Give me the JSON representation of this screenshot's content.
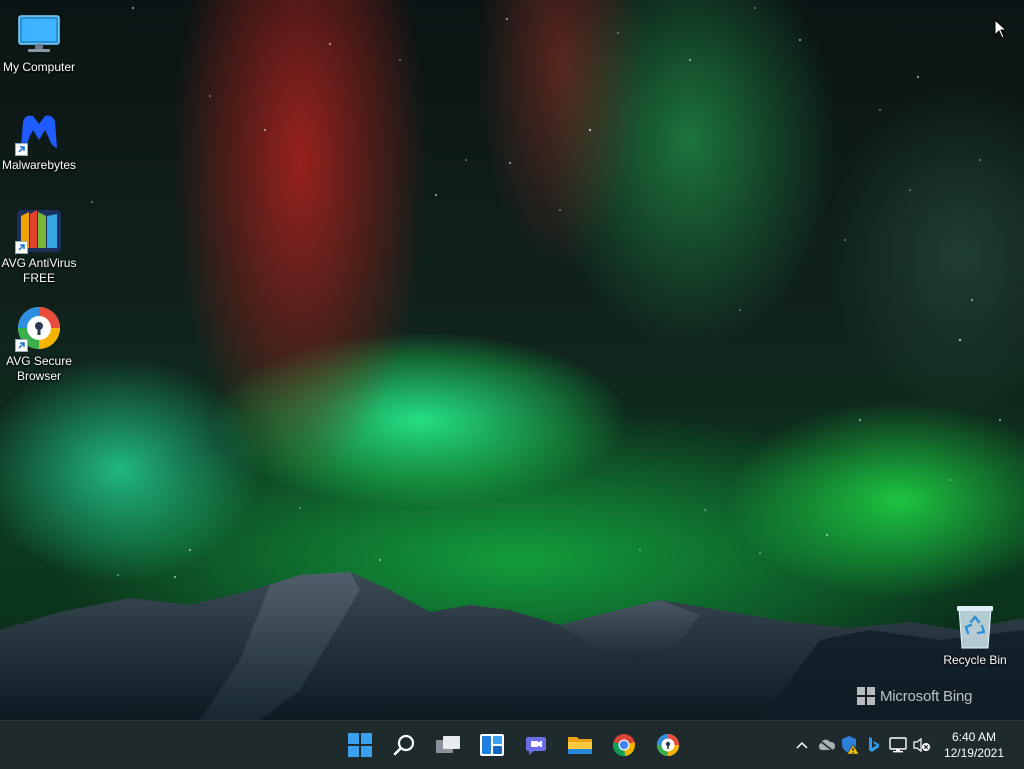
{
  "desktop": {
    "icons": [
      {
        "label": "My Computer",
        "icon": "computer-monitor-icon"
      },
      {
        "label": "Malwarebytes",
        "icon": "malwarebytes-logo-icon",
        "shortcut": true
      },
      {
        "label": "AVG AntiVirus FREE",
        "icon": "avg-antivirus-icon",
        "shortcut": true
      },
      {
        "label": "AVG Secure Browser",
        "icon": "avg-secure-browser-icon",
        "shortcut": true
      }
    ],
    "recycle_bin": {
      "label": "Recycle Bin",
      "icon": "recycle-bin-icon"
    },
    "watermark": "Microsoft Bing"
  },
  "taskbar": {
    "apps": [
      {
        "name": "Start",
        "icon": "windows-start-icon"
      },
      {
        "name": "Search",
        "icon": "search-icon"
      },
      {
        "name": "Task View",
        "icon": "task-view-icon"
      },
      {
        "name": "Widgets",
        "icon": "widgets-icon"
      },
      {
        "name": "Chat",
        "icon": "teams-chat-icon"
      },
      {
        "name": "File Explorer",
        "icon": "file-explorer-icon"
      },
      {
        "name": "Google Chrome",
        "icon": "chrome-icon"
      },
      {
        "name": "AVG Secure Browser",
        "icon": "avg-secure-browser-icon"
      }
    ],
    "tray": {
      "icons": [
        "chevron-up-icon",
        "onedrive-cloud-icon",
        "avg-shield-warning-icon",
        "bing-icon",
        "network-icon",
        "volume-muted-icon"
      ],
      "time": "6:40 AM",
      "date": "12/19/2021"
    }
  },
  "colors": {
    "taskbar_bg": "#1f2a2d",
    "windows_blue": "#3aa0f0"
  }
}
